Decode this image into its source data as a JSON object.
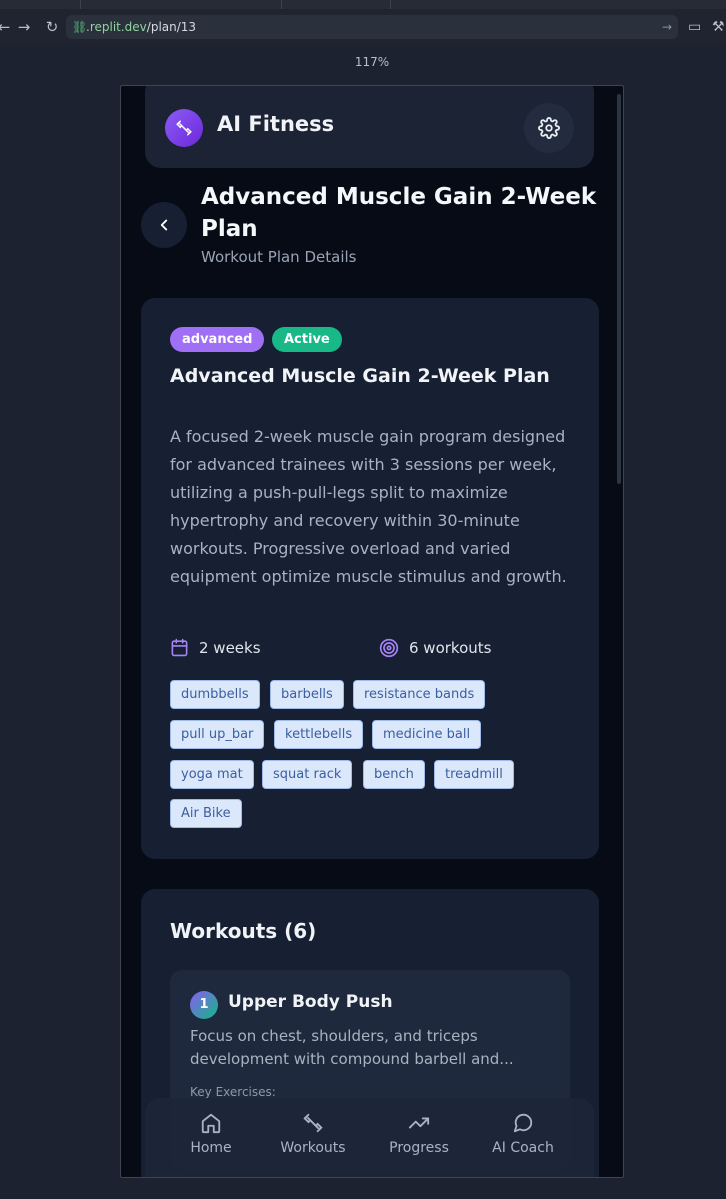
{
  "browser": {
    "url_domain": ".replit.dev",
    "url_path": "/plan/13",
    "zoom": "117%"
  },
  "header": {
    "app_title": "AI Fitness",
    "logo_icon": "dumbbell-icon",
    "settings_icon": "gear-icon"
  },
  "page": {
    "title": "Advanced Muscle Gain 2-Week Plan",
    "subtitle": "Workout Plan Details"
  },
  "plan": {
    "level": "advanced",
    "status": "Active",
    "name": "Advanced Muscle Gain 2-Week Plan",
    "description": "A focused 2-week muscle gain program designed for advanced trainees with 3 sessions per week, utilizing a push-pull-legs split to maximize hypertrophy and recovery within 30-minute workouts. Progressive overload and varied equipment optimize muscle stimulus and growth.",
    "duration": "2 weeks",
    "workout_count": "6 workouts",
    "equipment": [
      "dumbbells",
      "barbells",
      "resistance bands",
      "pull up_bar",
      "kettlebells",
      "medicine ball",
      "yoga mat",
      "squat rack",
      "bench",
      "treadmill",
      "Air Bike"
    ]
  },
  "workouts": {
    "title": "Workouts (6)",
    "items": [
      {
        "number": "1",
        "name": "Upper Body Push",
        "description": "Focus on chest, shoulders, and triceps development with compound barbell and...",
        "key_label": "Key Exercises:"
      }
    ]
  },
  "nav": {
    "items": [
      {
        "label": "Home",
        "icon": "home-icon"
      },
      {
        "label": "Workouts",
        "icon": "dumbbell-icon"
      },
      {
        "label": "Progress",
        "icon": "trending-up-icon"
      },
      {
        "label": "AI Coach",
        "icon": "chat-bubble-icon"
      }
    ]
  },
  "colors": {
    "level_badge": "#9f6ff5",
    "status_badge": "#19b987",
    "card": "#172033",
    "background": "#060b16"
  }
}
